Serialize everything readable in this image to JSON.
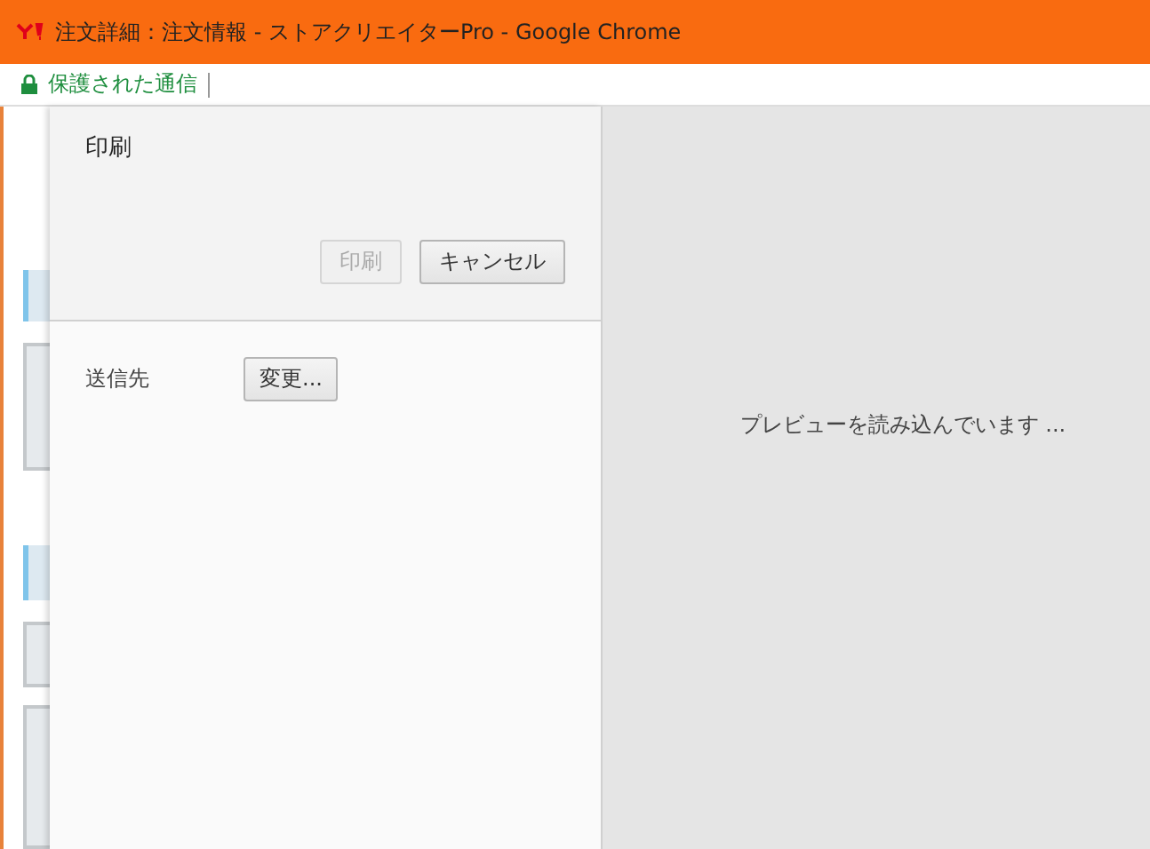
{
  "window": {
    "title": "注文詳細：注文情報 - ストアクリエイターPro - Google Chrome"
  },
  "address_bar": {
    "security_label": "保護された通信"
  },
  "print_dialog": {
    "title": "印刷",
    "buttons": [
      {
        "label": "印刷",
        "disabled": true
      },
      {
        "label": "キャンセル",
        "disabled": false
      }
    ],
    "destination": {
      "label": "送信先",
      "button": "変更..."
    }
  },
  "preview": {
    "message": "プレビューを読み込んでいます ..."
  }
}
